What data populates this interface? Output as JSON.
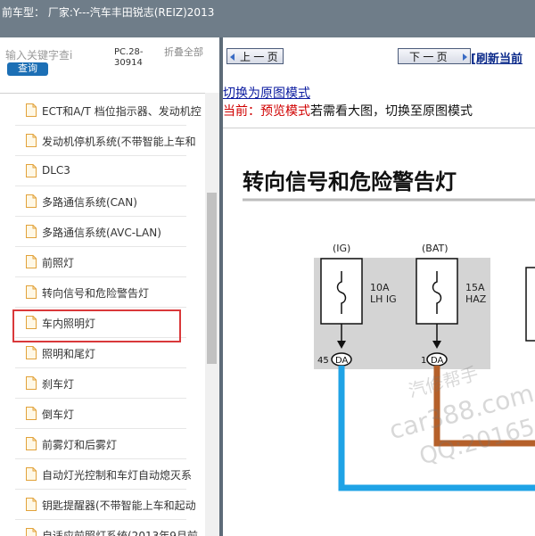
{
  "window": {
    "title": "前车型： 厂家:Y---汽车丰田锐志(REIZ)2013"
  },
  "search": {
    "placeholder": "输入关键字查i",
    "button_label": "查询"
  },
  "pc_code": "PC.28-30914",
  "collapse_all_label": "折叠全部",
  "tree": {
    "items": [
      {
        "label": "ECT和A/T 档位指示器、发动机控"
      },
      {
        "label": "发动机停机系统(不带智能上车和"
      },
      {
        "label": "DLC3"
      },
      {
        "label": "多路通信系统(CAN)"
      },
      {
        "label": "多路通信系统(AVC-LAN)"
      },
      {
        "label": "前照灯"
      },
      {
        "label": "转向信号和危险警告灯"
      },
      {
        "label": "车内照明灯"
      },
      {
        "label": "照明和尾灯"
      },
      {
        "label": "刹车灯"
      },
      {
        "label": "倒车灯"
      },
      {
        "label": "前雾灯和后雾灯"
      },
      {
        "label": "自动灯光控制和车灯自动熄灭系"
      },
      {
        "label": "钥匙提醒器(不带智能上车和起动"
      },
      {
        "label": "自适应前照灯系统(2013年9月前"
      }
    ],
    "selected_index": 6
  },
  "toolbar": {
    "prev_label": "上 一 页",
    "next_label": "下 一 页",
    "refresh_label": "[刷新当前"
  },
  "content": {
    "switch_link": "切换为原图模式",
    "mode_prefix": "当前：预览模式",
    "mode_suffix": "若需看大图，切换至原图模式"
  },
  "diagram": {
    "title": "转向信号和危险警告灯",
    "fuses": [
      {
        "source": "(IG)",
        "rating": "10A",
        "name": "LH IG",
        "pin": "45",
        "connector": "DA"
      },
      {
        "source": "(BAT)",
        "rating": "15A",
        "name": "HAZ",
        "pin": "1",
        "connector": "DA"
      }
    ],
    "watermark": {
      "line1": "汽修帮手",
      "line2": "car388.com",
      "line3": "QQ:20165"
    }
  },
  "colors": {
    "title_bar": "#6f7d89",
    "query_button": "#1c6fb5",
    "highlight_border": "#d9383a",
    "wire_blue": "#1fa3e6",
    "wire_brown": "#b5602a",
    "fuse_panel": "#d4d4d4"
  }
}
